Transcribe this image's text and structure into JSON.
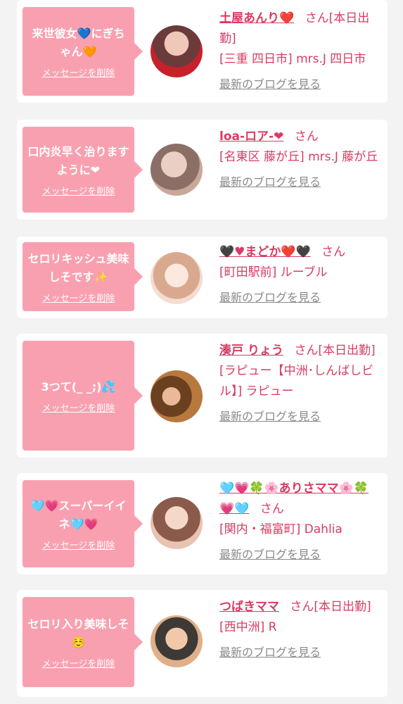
{
  "entries": [
    {
      "message": "来世彼女💙にぎちゃん🧡",
      "delete_label": "メッセージを削除",
      "name": "土屋あんり❤️",
      "san": "さん",
      "status": "[本日出勤]",
      "shop": "[三重 四日市] mrs.J 四日市",
      "blog_label": "最新のブログを見る",
      "avatar_colors": [
        "#6b3a3a",
        "#c8202a"
      ]
    },
    {
      "message": "口内炎早く治りますように❤",
      "delete_label": "メッセージを削除",
      "name": "loa-ロア-❤",
      "san": "さん",
      "status": "",
      "shop": "[名東区 藤が丘] mrs.J 藤が丘",
      "blog_label": "最新のブログを見る",
      "avatar_colors": [
        "#c8a89a",
        "#8b6f66"
      ]
    },
    {
      "message": "セロリキッシュ美味しそです✨",
      "delete_label": "メッセージを削除",
      "name": "🖤♥まどか❤️🖤",
      "san": "さん",
      "status": "",
      "shop": "[町田駅前] ルーブル",
      "blog_label": "最新のブログを見る",
      "avatar_colors": [
        "#f3ddd2",
        "#d9a98f"
      ]
    },
    {
      "message": "3つて(_ _;)💦",
      "delete_label": "メッセージを削除",
      "name": "湊戸 りょう",
      "san": "さん",
      "status": "[本日出勤]",
      "shop": "[ラピュー【中洲･しんばしビル】] ラピュー",
      "blog_label": "最新のブログを見る",
      "avatar_colors": [
        "#b8793f",
        "#6b4020"
      ]
    },
    {
      "message": "🩵💗スーパーイイネ🩵💗",
      "delete_label": "メッセージを削除",
      "name": "🩵💗🍀🌸ありさママ🌸🍀💗🩵",
      "san": "さん",
      "status": "",
      "shop": "[関内・福富町] Dahlia",
      "blog_label": "最新のブログを見る",
      "avatar_colors": [
        "#e8c2b2",
        "#8a5a4a"
      ]
    },
    {
      "message": "セロリ入り美味しそ☺️",
      "delete_label": "メッセージを削除",
      "name": "つばきママ",
      "san": "さん",
      "status": "[本日出勤]",
      "shop": "[西中洲] R",
      "blog_label": "最新のブログを見る",
      "avatar_colors": [
        "#e0b08a",
        "#3d3a36"
      ]
    }
  ]
}
